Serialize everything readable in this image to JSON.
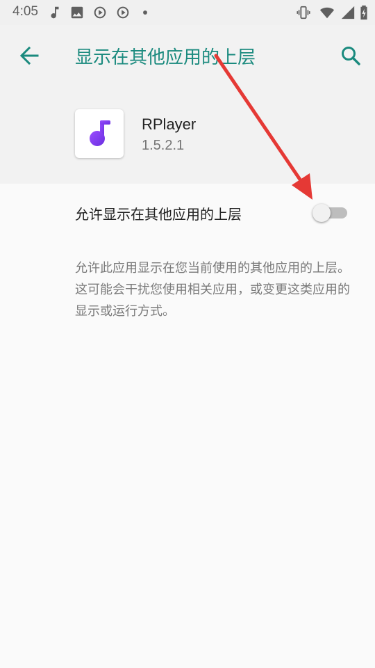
{
  "status_bar": {
    "time": "4:05",
    "left_icons": [
      "music-note-icon",
      "image-icon",
      "sync-play-icon",
      "sync-play-icon",
      "dot-icon"
    ],
    "right_icons": [
      "vibrate-icon",
      "wifi-icon",
      "signal-icon",
      "battery-charging-icon"
    ]
  },
  "toolbar": {
    "title": "显示在其他应用的上层",
    "back_icon": "arrow-back-icon",
    "search_icon": "search-icon"
  },
  "app": {
    "name": "RPlayer",
    "version": "1.5.2.1",
    "icon": "music-note-app-icon"
  },
  "setting": {
    "label": "允许显示在其他应用的上层",
    "enabled": false
  },
  "description": "允许此应用显示在您当前使用的其他应用的上层。这可能会干扰您使用相关应用，或变更这类应用的显示或运行方式。",
  "colors": {
    "accent": "#1a8a7e",
    "arrow": "#e53935",
    "app_icon": "#7c3aed"
  }
}
